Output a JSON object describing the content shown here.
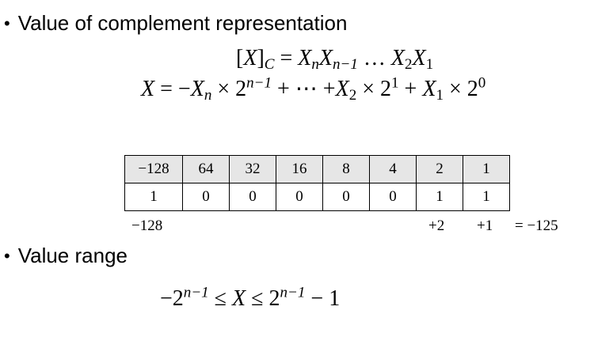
{
  "section1": {
    "bullet": "•",
    "title": "Value of complement representation"
  },
  "formula1": {
    "lhs_open": "[",
    "lhs_var": "X",
    "lhs_close": "]",
    "lhs_sub": "C",
    "eq": " = ",
    "X": "X",
    "n": "n",
    "n_minus_1": "n−1",
    "dots": " … ",
    "two": "2",
    "one": "1"
  },
  "formula2": {
    "X": "X",
    "eq": " = −",
    "n": "n",
    "times": " × ",
    "base": "2",
    "n_minus_1": "n−1",
    "plus": " + ",
    "cdots": "⋯",
    "plus_tight": " +",
    "sub2": "2",
    "exp1": "1",
    "sub1": "1",
    "exp0": "0"
  },
  "table": {
    "weights": [
      "−128",
      "64",
      "32",
      "16",
      "8",
      "4",
      "2",
      "1"
    ],
    "bits": [
      "1",
      "0",
      "0",
      "0",
      "0",
      "0",
      "1",
      "1"
    ]
  },
  "below_table": {
    "left": "−128",
    "plus2": "+2",
    "plus1": "+1",
    "result": "= −125"
  },
  "section2": {
    "bullet": "•",
    "title": "Value range"
  },
  "range": {
    "minus": "−",
    "base": "2",
    "n_minus_1": "n−1",
    "leq": " ≤ ",
    "X": "X",
    "minus_one": " − 1"
  }
}
